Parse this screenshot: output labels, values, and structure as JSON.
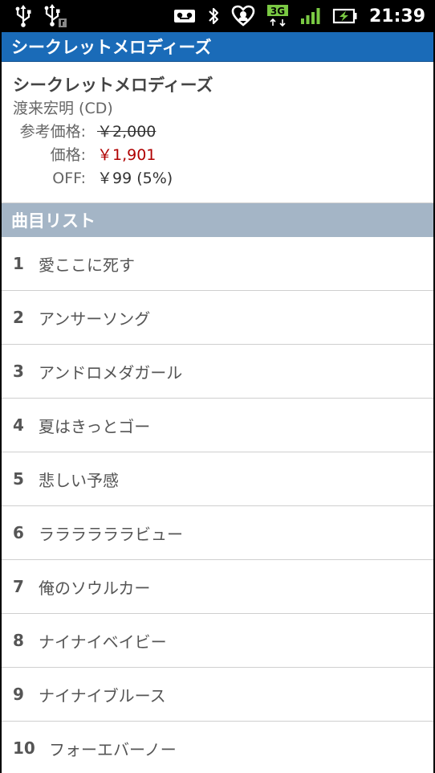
{
  "status_bar": {
    "time": "21:39",
    "network": "3G",
    "icons": [
      "usb-icon",
      "usb-debug-icon",
      "voicemail-icon",
      "bluetooth-icon",
      "heart-app-icon",
      "3g-icon",
      "signal-icon",
      "battery-charging-icon"
    ]
  },
  "header": {
    "title": "シークレットメロディーズ"
  },
  "album": {
    "title": "シークレットメロディーズ",
    "artist": "渡来宏明 (CD)",
    "list_price_label": "参考価格:",
    "list_price": "￥2,000",
    "price_label": "価格:",
    "price": "￥1,901",
    "off_label": "OFF:",
    "off": "￥99 (5%)"
  },
  "tracks_section": {
    "title": "曲目リスト"
  },
  "tracks": [
    {
      "no": "1",
      "title": "愛ここに死す"
    },
    {
      "no": "2",
      "title": "アンサーソング"
    },
    {
      "no": "3",
      "title": "アンドロメダガール"
    },
    {
      "no": "4",
      "title": "夏はきっとゴー"
    },
    {
      "no": "5",
      "title": "悲しい予感"
    },
    {
      "no": "6",
      "title": "ララララララビュー"
    },
    {
      "no": "7",
      "title": "俺のソウルカー"
    },
    {
      "no": "8",
      "title": "ナイナイベイビー"
    },
    {
      "no": "9",
      "title": "ナイナイブルース"
    },
    {
      "no": "10",
      "title": "フォーエバーノー"
    }
  ],
  "colors": {
    "title_bar": "#1a6bb8",
    "section_header": "#a4b5c6",
    "price_red": "#b00000",
    "network_badge": "#7ac943"
  }
}
